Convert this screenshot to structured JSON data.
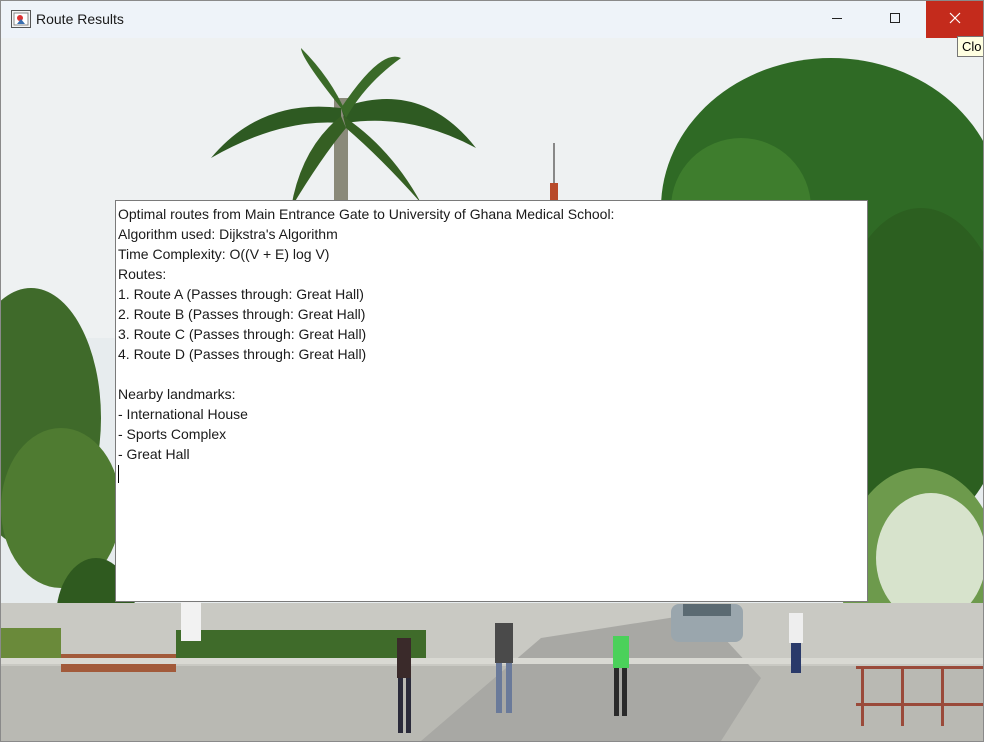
{
  "window": {
    "title": "Route Results",
    "tooltip": "Clo",
    "buttons": {
      "minimize": "minimize-icon",
      "maximize": "maximize-icon",
      "close": "close-icon"
    },
    "colors": {
      "titlebar": "#eef3f9",
      "close_hover": "#c42b1c"
    }
  },
  "results": {
    "lines": [
      "Optimal routes from Main Entrance Gate to University of Ghana Medical School:",
      "Algorithm used: Dijkstra's Algorithm",
      "Time Complexity: O((V + E) log V)",
      "Routes:",
      "1. Route A (Passes through: Great Hall)",
      "2. Route B (Passes through: Great Hall)",
      "3. Route C (Passes through: Great Hall)",
      "4. Route D (Passes through: Great Hall)",
      "",
      "Nearby landmarks:",
      "- International House",
      "- Sports Complex",
      "- Great Hall"
    ]
  }
}
